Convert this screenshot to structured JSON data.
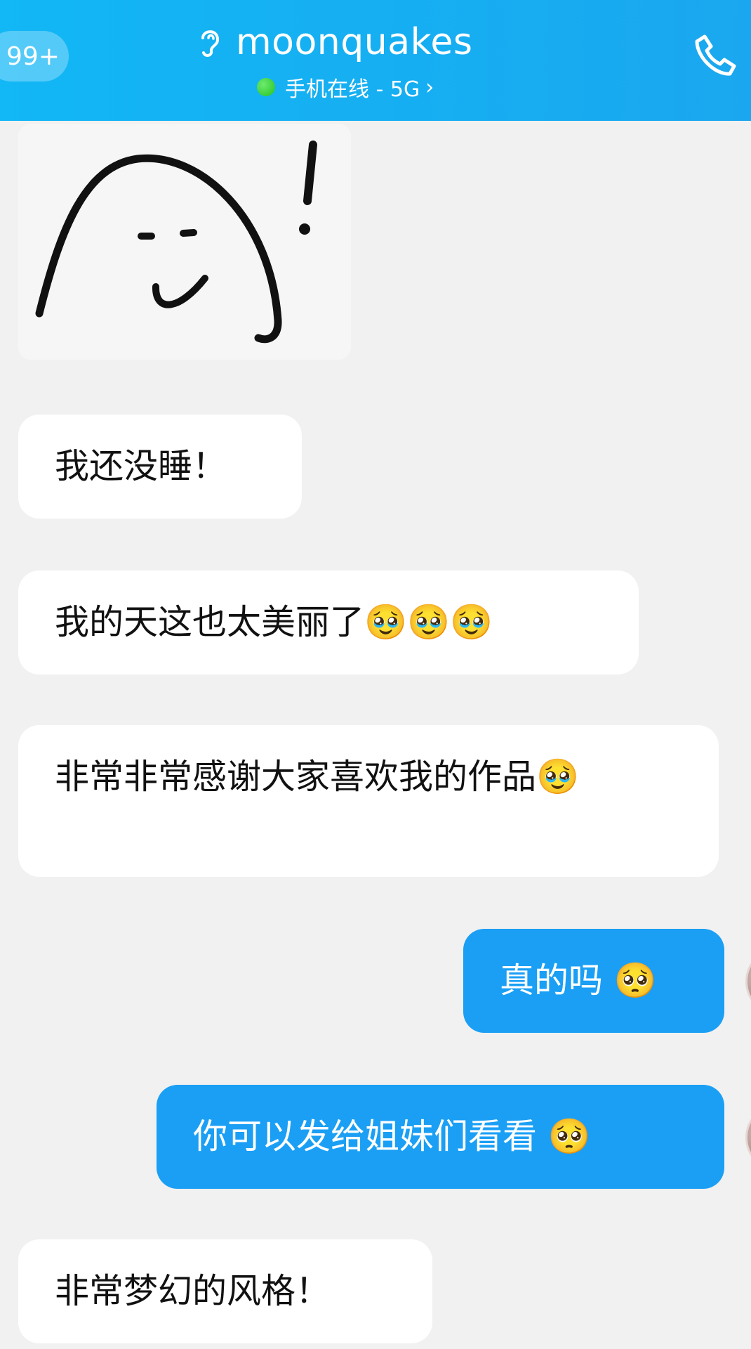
{
  "header": {
    "back_badge": "99+",
    "title": "moonquakes",
    "status": "手机在线 - 5G",
    "chevron": "›",
    "icons": {
      "ear": "ear-icon",
      "phone": "phone-icon",
      "online": "online-dot"
    },
    "color": "#12b7f5"
  },
  "messages": [
    {
      "side": "in",
      "type": "sticker",
      "icon": "smiling-ghost-sticker-with-exclamation"
    },
    {
      "side": "in",
      "text": "我还没睡！"
    },
    {
      "side": "in",
      "text": "我的天这也太美丽了🥹🥹🥹"
    },
    {
      "side": "in",
      "text": "非常非常感谢大家喜欢我的作品🥹"
    },
    {
      "side": "out",
      "text": "真的吗 🥺"
    },
    {
      "side": "out",
      "text": "你可以发给姐妹们看看 🥺"
    },
    {
      "side": "in",
      "text": "非常梦幻的风格！"
    }
  ],
  "colors": {
    "incoming_bubble": "#ffffff",
    "outgoing_bubble": "#1a9ff5",
    "background": "#f1f1f1"
  }
}
